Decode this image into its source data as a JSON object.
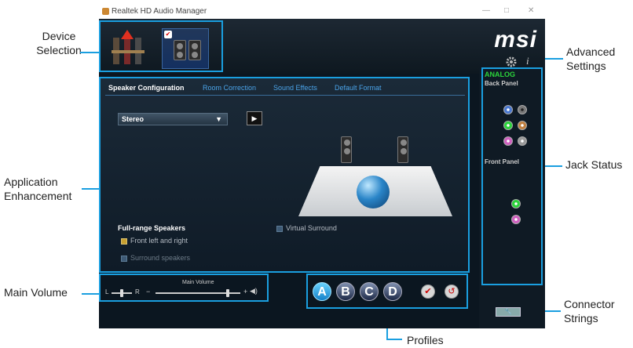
{
  "window": {
    "title": "Realtek HD Audio Manager",
    "logo": "msi",
    "controls": [
      "—",
      "□",
      "✕"
    ]
  },
  "tabs": [
    "Speaker Configuration",
    "Room Correction",
    "Sound Effects",
    "Default Format"
  ],
  "speaker_config": {
    "selected": "Stereo",
    "fullrange_label": "Full-range Speakers",
    "front_lr": "Front left and right",
    "surround": "Surround speakers",
    "virtual_surround": "Virtual Surround"
  },
  "volume": {
    "label": "Main Volume",
    "balance_left": "L",
    "balance_right": "R",
    "minus": "−",
    "plus": "+"
  },
  "profiles": [
    "A",
    "B",
    "C",
    "D"
  ],
  "jack_panel": {
    "section": "ANALOG",
    "back_panel": "Back Panel",
    "front_panel": "Front Panel"
  },
  "callouts": {
    "device_selection": "Device\nSelection",
    "app_enhancement": "Application\nEnhancement",
    "main_volume": "Main Volume",
    "profiles": "Profiles",
    "advanced_settings": "Advanced\nSettings",
    "jack_status": "Jack Status",
    "connector_strings": "Connector\nStrings"
  },
  "colors": {
    "accent": "#1a9fe0",
    "analog_green": "#2bd33b"
  },
  "icons": [
    "gear-icon",
    "info-icon",
    "play-icon",
    "speaker-icon",
    "check-icon",
    "wrench-icon"
  ]
}
